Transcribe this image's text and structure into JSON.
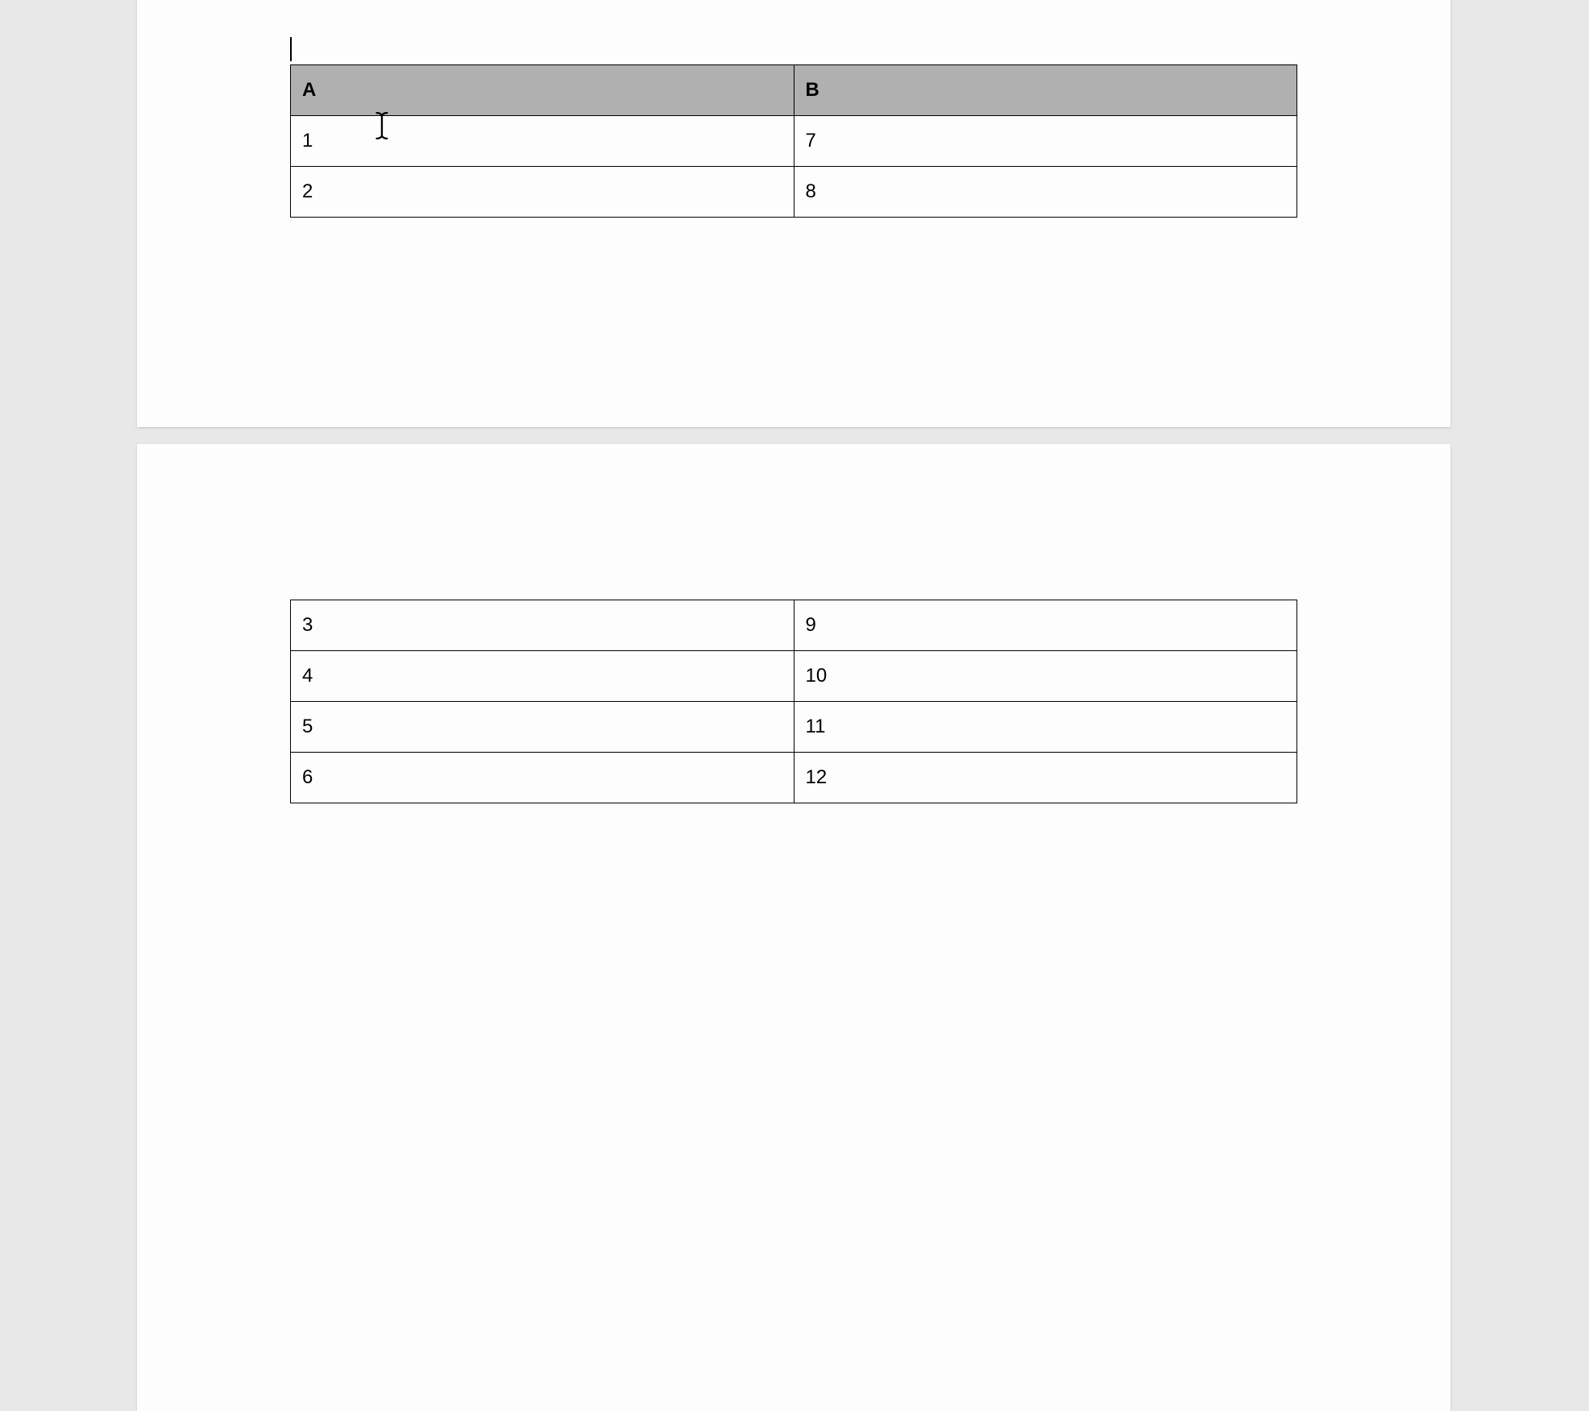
{
  "table": {
    "headers": {
      "col_a": "A",
      "col_b": "B"
    },
    "page1_rows": [
      {
        "a": "1",
        "b": "7"
      },
      {
        "a": "2",
        "b": "8"
      }
    ],
    "page2_rows": [
      {
        "a": "3",
        "b": "9"
      },
      {
        "a": "4",
        "b": "10"
      },
      {
        "a": "5",
        "b": "11"
      },
      {
        "a": "6",
        "b": "12"
      }
    ]
  }
}
